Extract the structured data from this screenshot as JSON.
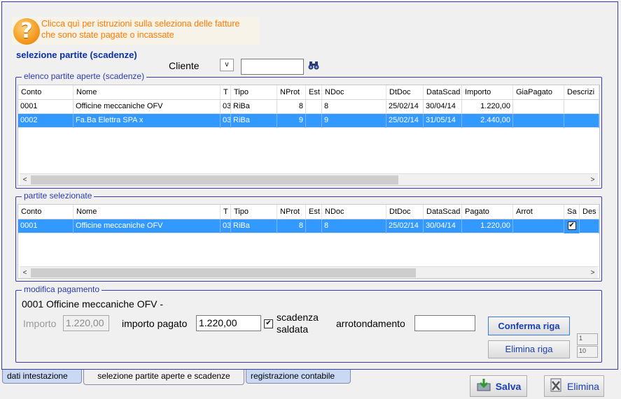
{
  "help": {
    "text": "Clicca quì per istruzioni sulla seleziona delle fatture che sono state pagate o incassate",
    "icon": "question-icon"
  },
  "title": "selezione partite (scadenze)",
  "cliente": {
    "label": "Cliente",
    "dropdown": "v",
    "value": ""
  },
  "open_group": {
    "legend": "elenco partite aperte (scadenze)",
    "columns": [
      "Conto",
      "Nome",
      "T",
      "Tipo",
      "NProt",
      "Est",
      "NDoc",
      "DtDoc",
      "DataScad",
      "Importo",
      "GiaPagato",
      "Descrizi"
    ],
    "rows": [
      [
        "0001",
        "Officine meccaniche OFV",
        "03",
        "RiBa",
        "8",
        "",
        "8",
        "25/02/14",
        "30/04/14",
        "1.220,00",
        "",
        ""
      ],
      [
        "0002",
        "Fa.Ba Elettra SPA x",
        "03",
        "RiBa",
        "9",
        "",
        "9",
        "25/02/14",
        "31/05/14",
        "2.440,00",
        "",
        ""
      ]
    ]
  },
  "sel_group": {
    "legend": "partite selezionate",
    "columns": [
      "Conto",
      "Nome",
      "T",
      "Tipo",
      "NProt",
      "Est",
      "NDoc",
      "DtDoc",
      "DataScad",
      "Pagato",
      "Arrot",
      "Sa",
      "Des"
    ],
    "rows": [
      [
        "0001",
        "Officine meccaniche OFV",
        "03",
        "RiBa",
        "8",
        "",
        "8",
        "25/02/14",
        "30/04/14",
        "1.220,00",
        "",
        "✔",
        ""
      ]
    ]
  },
  "modifica": {
    "legend": "modifica pagamento",
    "header": "0001 Officine meccaniche OFV -",
    "importo_label": "Importo",
    "importo_value": "1.220,00",
    "pagato_label": "importo pagato",
    "pagato_value": "1.220,00",
    "saldata_label_1": "scadenza",
    "saldata_label_2": "saldata",
    "saldata_checked": "✔",
    "arrot_label": "arrotondamento",
    "arrot_value": "",
    "conferma": "Conferma riga",
    "elimina_riga": "Elimina riga",
    "counter_1": "1",
    "counter_2": "10"
  },
  "tabs": [
    "dati intestazione",
    "selezione partite aperte e scadenze",
    "registrazione contabile"
  ],
  "footer": {
    "salva": "Salva",
    "elimina": "Elimina"
  }
}
